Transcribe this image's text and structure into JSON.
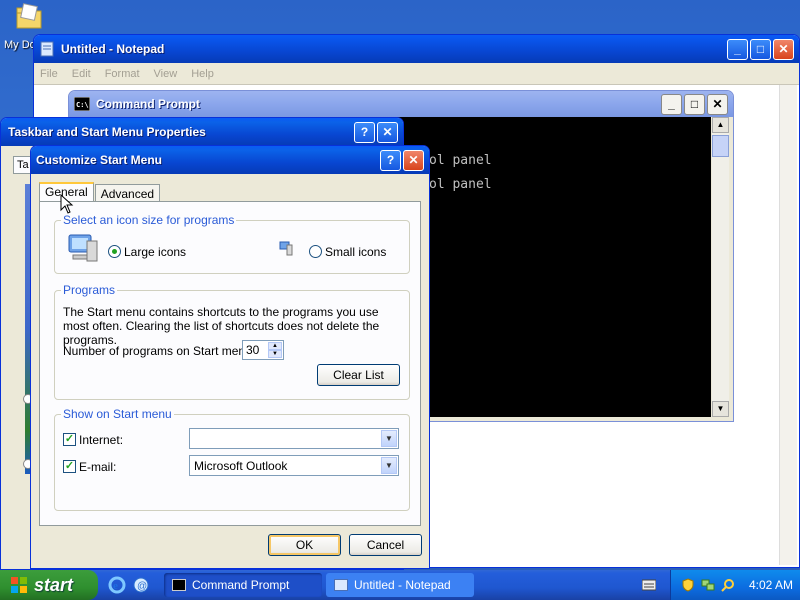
{
  "desktop": {
    "icon_label": "My Do"
  },
  "notepad": {
    "title": "Untitled - Notepad",
    "menu": [
      "File",
      "Edit",
      "Format",
      "View",
      "Help"
    ]
  },
  "cmd": {
    "title": "Command Prompt",
    "lines": [
      "ol panel",
      "ol panel"
    ]
  },
  "tbprops": {
    "title": "Taskbar and Start Menu Properties",
    "tab_fragment": "Ta"
  },
  "csm": {
    "title": "Customize Start Menu",
    "tabs": [
      "General",
      "Advanced"
    ],
    "icon_size": {
      "legend": "Select an icon size for programs",
      "large_label": "Large icons",
      "small_label": "Small icons",
      "selected": "large"
    },
    "programs": {
      "legend": "Programs",
      "description": "The Start menu contains shortcuts to the programs you use most often. Clearing the list of shortcuts does not delete the programs.",
      "count_label": "Number of programs on Start menu:",
      "count_value": "30",
      "clear_button": "Clear List"
    },
    "show_on_start": {
      "legend": "Show on Start menu",
      "internet_label": "Internet:",
      "internet_value": "",
      "email_label": "E-mail:",
      "email_value": "Microsoft Outlook"
    },
    "ok_label": "OK",
    "cancel_label": "Cancel"
  },
  "taskbar": {
    "start_label": "start",
    "tasks": [
      "Command Prompt",
      "Untitled - Notepad"
    ],
    "clock": "4:02 AM"
  },
  "colors": {
    "title_active": "#0846d1",
    "legend_blue": "#2a5bd7",
    "start_green": "#2f8f2f",
    "desktop_blue": "#3a77d4"
  }
}
